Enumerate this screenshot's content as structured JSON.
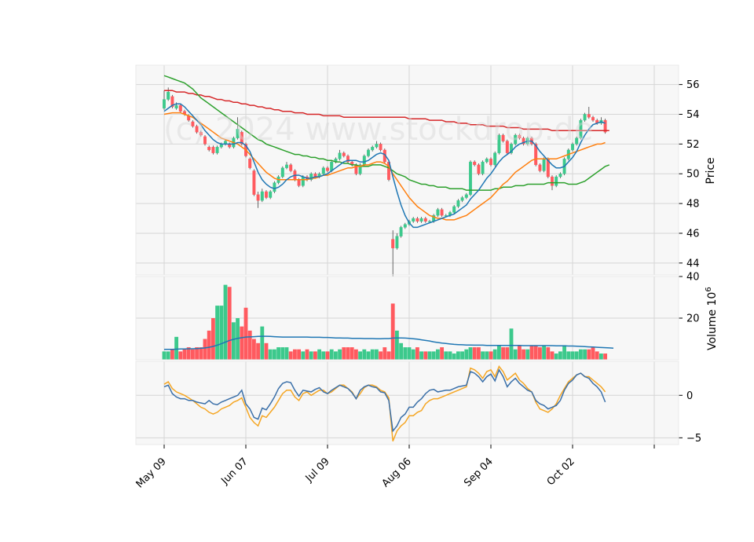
{
  "chart_data": {
    "type": "candlestick",
    "watermark": "(c) 2024 www.stockdrop.de",
    "x_tick_labels": [
      "May 09",
      "Jun 07",
      "Jul 09",
      "Aug 06",
      "Sep 04",
      "Oct 02",
      ""
    ],
    "x_tick_index": [
      0,
      20,
      40,
      60,
      80,
      100,
      120
    ],
    "price_axis": {
      "label": "Price",
      "ticks": [
        44,
        46,
        48,
        50,
        52,
        54,
        56
      ],
      "ylim": [
        43.2,
        57.3
      ]
    },
    "volume_axis": {
      "label": "Volume  10^6",
      "ticks": [
        20,
        40
      ],
      "ylim": [
        0,
        40
      ]
    },
    "osc_axis": {
      "ticks": [
        -5,
        0
      ],
      "ylim": [
        -5.8,
        4.0
      ]
    },
    "colors": {
      "up": "#3cc98c",
      "down": "#ff5a5f",
      "ma_short": "#1f77b4",
      "ma_mid": "#ff7f0e",
      "ma_long": "#2ca02c",
      "ma_200": "#d62728",
      "osc_1": "#3a6fa8",
      "osc_2": "#f5a623",
      "vol_avg": "#1f77b4",
      "panel_bg": "#f7f7f7",
      "grid": "#d6d6d6"
    },
    "close": [
      55.0,
      55.5,
      54.5,
      54.6,
      54.2,
      54.0,
      53.6,
      53.2,
      52.8,
      52.6,
      52.0,
      51.6,
      51.4,
      51.8,
      52.0,
      52.2,
      51.8,
      52.4,
      53.0,
      52.0,
      51.2,
      50.4,
      48.6,
      48.2,
      48.8,
      48.4,
      48.8,
      49.4,
      49.8,
      50.4,
      50.6,
      50.2,
      49.6,
      49.2,
      49.8,
      49.6,
      50.0,
      49.8,
      50.0,
      50.4,
      50.2,
      50.8,
      51.0,
      51.4,
      51.2,
      50.8,
      50.6,
      50.0,
      50.6,
      51.2,
      51.6,
      51.8,
      52.0,
      51.6,
      50.8,
      49.6,
      45.0,
      45.8,
      46.4,
      46.6,
      46.8,
      47.0,
      46.8,
      47.0,
      46.8,
      46.8,
      47.2,
      47.6,
      47.2,
      47.2,
      47.4,
      47.8,
      48.2,
      48.4,
      48.6,
      50.8,
      50.6,
      50.0,
      50.8,
      51.0,
      50.6,
      51.4,
      52.6,
      52.2,
      51.4,
      52.0,
      52.6,
      52.4,
      52.0,
      52.4,
      52.0,
      50.6,
      50.2,
      51.0,
      49.8,
      49.2,
      49.8,
      50.0,
      51.0,
      51.6,
      52.0,
      52.4,
      53.6,
      54.0,
      53.8,
      53.6,
      53.4,
      53.6,
      52.8
    ],
    "open": [
      54.4,
      55.0,
      55.2,
      54.4,
      54.6,
      54.2,
      53.9,
      53.5,
      53.2,
      52.8,
      52.5,
      51.8,
      51.8,
      51.4,
      51.8,
      52.0,
      52.0,
      51.8,
      52.4,
      52.8,
      52.0,
      51.0,
      50.2,
      48.6,
      48.2,
      48.8,
      48.4,
      48.8,
      49.4,
      49.8,
      50.4,
      50.6,
      50.2,
      49.6,
      49.2,
      49.8,
      49.6,
      50.0,
      49.8,
      50.0,
      50.4,
      50.2,
      50.8,
      51.0,
      51.4,
      51.2,
      50.8,
      50.6,
      50.0,
      50.6,
      51.2,
      51.6,
      51.8,
      52.0,
      51.6,
      50.8,
      45.6,
      45.0,
      45.8,
      46.4,
      46.6,
      46.8,
      47.0,
      46.8,
      47.0,
      46.8,
      46.8,
      47.2,
      47.6,
      47.2,
      47.2,
      47.4,
      47.8,
      48.2,
      48.4,
      48.6,
      50.8,
      50.6,
      50.0,
      50.8,
      51.0,
      50.6,
      51.4,
      52.6,
      52.2,
      51.4,
      52.0,
      52.6,
      52.4,
      52.0,
      52.4,
      52.0,
      50.6,
      50.2,
      51.0,
      49.8,
      49.2,
      49.8,
      50.0,
      51.0,
      51.6,
      52.0,
      52.4,
      53.6,
      54.0,
      53.8,
      53.6,
      53.4,
      53.6
    ],
    "high": [
      55.6,
      55.8,
      55.3,
      54.8,
      54.7,
      54.3,
      54.0,
      53.6,
      53.3,
      52.9,
      52.6,
      51.9,
      51.9,
      51.9,
      52.1,
      52.3,
      52.1,
      52.5,
      53.8,
      52.9,
      52.1,
      51.1,
      50.3,
      48.8,
      49.0,
      48.9,
      48.9,
      49.5,
      49.9,
      50.5,
      50.8,
      50.7,
      50.3,
      49.7,
      49.9,
      49.9,
      50.1,
      50.1,
      50.1,
      50.5,
      50.5,
      50.9,
      51.1,
      51.6,
      51.5,
      51.3,
      50.9,
      50.7,
      50.7,
      51.3,
      51.7,
      51.9,
      52.2,
      52.1,
      51.7,
      50.9,
      46.2,
      46.0,
      46.5,
      46.7,
      46.9,
      47.1,
      47.1,
      47.1,
      47.1,
      46.9,
      47.3,
      47.7,
      47.7,
      47.3,
      47.5,
      47.9,
      48.3,
      48.5,
      48.7,
      50.9,
      50.9,
      50.7,
      50.9,
      51.1,
      51.1,
      51.5,
      52.7,
      52.7,
      52.3,
      52.1,
      52.7,
      52.7,
      52.5,
      52.5,
      52.5,
      52.1,
      50.7,
      51.1,
      51.1,
      49.9,
      49.9,
      50.1,
      51.1,
      51.7,
      52.1,
      52.5,
      53.7,
      54.1,
      54.5,
      53.9,
      53.7,
      53.8,
      53.7
    ],
    "low": [
      54.3,
      54.9,
      54.4,
      54.3,
      54.1,
      53.9,
      53.5,
      53.1,
      52.7,
      52.5,
      51.9,
      51.5,
      51.3,
      51.3,
      51.7,
      51.9,
      51.7,
      51.7,
      52.3,
      51.9,
      51.1,
      50.3,
      48.5,
      47.7,
      48.1,
      48.3,
      48.3,
      48.7,
      49.3,
      49.7,
      50.3,
      50.1,
      49.5,
      49.1,
      49.1,
      49.5,
      49.5,
      49.7,
      49.7,
      49.9,
      50.1,
      50.1,
      50.7,
      50.9,
      51.1,
      50.7,
      50.5,
      49.9,
      49.9,
      50.5,
      51.1,
      51.5,
      51.7,
      51.5,
      50.7,
      49.5,
      43.0,
      44.9,
      45.7,
      46.3,
      46.5,
      46.7,
      46.7,
      46.7,
      46.7,
      46.7,
      46.7,
      47.1,
      47.1,
      47.1,
      47.1,
      47.3,
      47.7,
      48.1,
      48.3,
      48.5,
      50.5,
      49.9,
      49.9,
      50.7,
      50.5,
      50.5,
      51.3,
      52.1,
      51.3,
      51.3,
      51.9,
      52.3,
      51.9,
      51.9,
      51.9,
      50.5,
      50.1,
      50.1,
      49.7,
      48.9,
      49.1,
      49.7,
      49.9,
      50.9,
      51.5,
      51.9,
      52.3,
      53.5,
      53.7,
      53.5,
      53.3,
      53.3,
      52.7
    ],
    "volume": [
      4,
      4,
      5,
      11,
      4,
      5,
      6,
      5,
      6,
      6,
      10,
      14,
      20,
      26,
      26,
      36,
      35,
      18,
      20,
      16,
      25,
      14,
      10,
      8,
      16,
      8,
      5,
      5,
      6,
      6,
      6,
      4,
      5,
      5,
      4,
      5,
      4,
      4,
      5,
      4,
      4,
      5,
      4,
      5,
      6,
      6,
      6,
      5,
      4,
      5,
      4,
      5,
      5,
      4,
      6,
      4,
      27,
      14,
      8,
      6,
      6,
      5,
      6,
      4,
      4,
      4,
      4,
      5,
      6,
      4,
      4,
      3,
      4,
      4,
      5,
      6,
      6,
      6,
      4,
      4,
      4,
      5,
      7,
      6,
      6,
      15,
      5,
      7,
      5,
      5,
      7,
      7,
      6,
      7,
      6,
      4,
      3,
      4,
      7,
      4,
      4,
      4,
      5,
      5,
      5,
      6,
      4,
      3,
      3,
      4,
      6
    ],
    "ma_short": [
      54.2,
      54.4,
      54.6,
      54.7,
      54.7,
      54.5,
      54.2,
      53.9,
      53.6,
      53.3,
      52.9,
      52.6,
      52.3,
      52.1,
      52.0,
      52.0,
      52.0,
      52.0,
      52.1,
      52.1,
      51.9,
      51.5,
      50.8,
      50.1,
      49.6,
      49.3,
      49.1,
      49.0,
      49.1,
      49.3,
      49.6,
      49.8,
      49.9,
      49.9,
      49.8,
      49.7,
      49.7,
      49.8,
      49.8,
      49.9,
      50.0,
      50.2,
      50.4,
      50.6,
      50.8,
      50.9,
      50.9,
      50.9,
      50.8,
      50.8,
      50.9,
      51.1,
      51.3,
      51.4,
      51.3,
      50.9,
      49.8,
      48.8,
      47.9,
      47.2,
      46.7,
      46.4,
      46.4,
      46.5,
      46.6,
      46.7,
      46.8,
      46.9,
      47.0,
      47.1,
      47.2,
      47.3,
      47.5,
      47.7,
      47.9,
      48.3,
      48.6,
      48.9,
      49.3,
      49.7,
      50.0,
      50.4,
      50.8,
      51.1,
      51.3,
      51.5,
      51.8,
      52.0,
      52.1,
      52.2,
      52.2,
      51.9,
      51.5,
      51.2,
      50.9,
      50.6,
      50.4,
      50.4,
      50.5,
      50.8,
      51.1,
      51.5,
      52.1,
      52.6,
      53.0,
      53.3,
      53.4,
      53.5,
      53.4
    ],
    "ma_mid": [
      54.0,
      54.05,
      54.1,
      54.1,
      54.1,
      54.0,
      53.9,
      53.8,
      53.6,
      53.4,
      53.2,
      53.0,
      52.8,
      52.6,
      52.4,
      52.3,
      52.2,
      52.1,
      52.0,
      51.8,
      51.6,
      51.3,
      51.0,
      50.7,
      50.4,
      50.1,
      49.9,
      49.7,
      49.6,
      49.6,
      49.6,
      49.6,
      49.6,
      49.6,
      49.6,
      49.6,
      49.7,
      49.7,
      49.8,
      49.9,
      49.9,
      50.0,
      50.1,
      50.2,
      50.3,
      50.4,
      50.4,
      50.5,
      50.5,
      50.6,
      50.6,
      50.7,
      50.8,
      50.8,
      50.7,
      50.5,
      50.0,
      49.6,
      49.2,
      48.8,
      48.4,
      48.1,
      47.8,
      47.6,
      47.4,
      47.2,
      47.1,
      47.0,
      47.0,
      46.9,
      46.9,
      46.9,
      47.0,
      47.1,
      47.2,
      47.4,
      47.6,
      47.8,
      48.0,
      48.2,
      48.4,
      48.7,
      49.0,
      49.3,
      49.5,
      49.8,
      50.1,
      50.3,
      50.5,
      50.7,
      50.9,
      51.0,
      51.0,
      51.0,
      51.0,
      51.0,
      51.0,
      51.1,
      51.2,
      51.3,
      51.4,
      51.5,
      51.6,
      51.7,
      51.8,
      51.9,
      52.0,
      52.0,
      52.1
    ],
    "ma_long": [
      56.6,
      56.5,
      56.4,
      56.3,
      56.2,
      56.1,
      55.9,
      55.7,
      55.4,
      55.1,
      54.9,
      54.7,
      54.5,
      54.3,
      54.1,
      53.9,
      53.7,
      53.5,
      53.3,
      53.1,
      52.9,
      52.7,
      52.5,
      52.3,
      52.2,
      52.0,
      51.9,
      51.8,
      51.7,
      51.6,
      51.5,
      51.4,
      51.3,
      51.3,
      51.2,
      51.2,
      51.1,
      51.1,
      51.0,
      51.0,
      50.9,
      50.9,
      50.8,
      50.8,
      50.7,
      50.7,
      50.6,
      50.6,
      50.5,
      50.5,
      50.5,
      50.6,
      50.6,
      50.6,
      50.5,
      50.4,
      50.2,
      50.0,
      49.9,
      49.8,
      49.6,
      49.5,
      49.4,
      49.3,
      49.3,
      49.2,
      49.2,
      49.1,
      49.1,
      49.1,
      49.0,
      49.0,
      49.0,
      49.0,
      48.9,
      48.9,
      48.9,
      48.9,
      48.9,
      48.9,
      48.9,
      49.0,
      49.0,
      49.1,
      49.1,
      49.1,
      49.2,
      49.2,
      49.2,
      49.3,
      49.3,
      49.3,
      49.3,
      49.3,
      49.4,
      49.4,
      49.4,
      49.4,
      49.4,
      49.3,
      49.3,
      49.3,
      49.4,
      49.5,
      49.7,
      49.9,
      50.1,
      50.3,
      50.5,
      50.6
    ],
    "ma_200": [
      55.6,
      55.6,
      55.6,
      55.5,
      55.5,
      55.5,
      55.4,
      55.4,
      55.3,
      55.3,
      55.2,
      55.2,
      55.1,
      55.0,
      55.0,
      54.9,
      54.9,
      54.8,
      54.8,
      54.7,
      54.7,
      54.6,
      54.6,
      54.5,
      54.5,
      54.4,
      54.4,
      54.3,
      54.3,
      54.2,
      54.2,
      54.2,
      54.1,
      54.1,
      54.1,
      54.0,
      54.0,
      54.0,
      54.0,
      53.9,
      53.9,
      53.9,
      53.9,
      53.9,
      53.8,
      53.8,
      53.8,
      53.8,
      53.8,
      53.8,
      53.8,
      53.8,
      53.8,
      53.8,
      53.8,
      53.8,
      53.8,
      53.8,
      53.8,
      53.8,
      53.7,
      53.7,
      53.7,
      53.7,
      53.7,
      53.6,
      53.6,
      53.6,
      53.6,
      53.5,
      53.5,
      53.5,
      53.4,
      53.4,
      53.4,
      53.3,
      53.3,
      53.3,
      53.3,
      53.2,
      53.2,
      53.2,
      53.2,
      53.2,
      53.1,
      53.1,
      53.1,
      53.1,
      53.0,
      53.0,
      53.0,
      53.0,
      53.0,
      53.0,
      53.0,
      52.9,
      52.9,
      52.9,
      52.9,
      52.9,
      52.9,
      52.9,
      52.9,
      52.9,
      52.9,
      52.9,
      52.9,
      52.9,
      52.9,
      52.9
    ],
    "vol_avg": [
      5.0,
      5.0,
      5.0,
      5.1,
      5.2,
      5.2,
      5.3,
      5.3,
      5.4,
      5.5,
      5.7,
      6.0,
      6.4,
      7.0,
      7.7,
      8.5,
      9.3,
      9.8,
      10.3,
      10.6,
      10.9,
      11.0,
      11.1,
      11.2,
      11.3,
      11.3,
      11.2,
      11.1,
      11.0,
      10.9,
      10.9,
      10.9,
      10.9,
      10.9,
      10.9,
      10.9,
      10.8,
      10.8,
      10.8,
      10.7,
      10.7,
      10.6,
      10.5,
      10.5,
      10.4,
      10.4,
      10.3,
      10.3,
      10.3,
      10.2,
      10.2,
      10.2,
      10.1,
      10.1,
      10.2,
      10.2,
      10.4,
      10.5,
      10.5,
      10.4,
      10.3,
      10.1,
      9.9,
      9.6,
      9.3,
      9.0,
      8.6,
      8.3,
      8.0,
      7.8,
      7.6,
      7.4,
      7.3,
      7.2,
      7.1,
      7.1,
      7.0,
      7.0,
      7.0,
      6.9,
      6.9,
      6.9,
      6.9,
      6.9,
      6.9,
      6.9,
      6.9,
      6.9,
      6.8,
      6.8,
      6.8,
      6.8,
      6.8,
      6.8,
      6.8,
      6.8,
      6.7,
      6.7,
      6.7,
      6.6,
      6.6,
      6.5,
      6.4,
      6.3,
      6.2,
      6.1,
      6.0,
      5.9,
      5.8,
      5.7,
      5.6
    ],
    "osc_1": [
      1.0,
      1.2,
      0.2,
      -0.2,
      -0.4,
      -0.4,
      -0.6,
      -0.6,
      -0.8,
      -0.9,
      -1.0,
      -0.6,
      -1.0,
      -1.1,
      -0.8,
      -0.6,
      -0.4,
      -0.2,
      0.0,
      0.6,
      -1.0,
      -1.6,
      -2.6,
      -2.8,
      -1.5,
      -1.7,
      -1.0,
      -0.2,
      0.8,
      1.4,
      1.6,
      1.5,
      0.6,
      -0.1,
      0.6,
      0.5,
      0.4,
      0.7,
      0.9,
      0.4,
      0.2,
      0.6,
      0.9,
      1.2,
      1.0,
      0.8,
      0.3,
      -0.4,
      0.6,
      1.0,
      1.2,
      1.0,
      0.9,
      0.4,
      0.3,
      -0.6,
      -4.2,
      -3.6,
      -2.6,
      -2.2,
      -1.4,
      -1.4,
      -0.8,
      -0.4,
      0.2,
      0.6,
      0.7,
      0.4,
      0.5,
      0.6,
      0.6,
      0.8,
      1.0,
      1.1,
      1.2,
      2.8,
      2.6,
      2.2,
      1.6,
      2.2,
      2.5,
      1.7,
      3.0,
      2.2,
      1.0,
      1.6,
      2.0,
      1.4,
      1.0,
      0.6,
      0.4,
      -0.6,
      -1.0,
      -1.2,
      -1.6,
      -1.4,
      -1.2,
      -0.6,
      0.6,
      1.4,
      1.8,
      2.4,
      2.6,
      2.2,
      2.0,
      1.4,
      1.0,
      0.4,
      -0.8
    ],
    "osc_2": [
      1.3,
      1.6,
      0.8,
      0.4,
      0.2,
      0.0,
      -0.3,
      -0.6,
      -1.0,
      -1.4,
      -1.6,
      -2.0,
      -2.2,
      -2.0,
      -1.6,
      -1.4,
      -1.2,
      -0.8,
      -0.6,
      -0.3,
      -1.4,
      -2.6,
      -3.2,
      -3.6,
      -2.4,
      -2.6,
      -2.0,
      -1.4,
      -0.6,
      0.2,
      0.6,
      0.6,
      -0.2,
      -0.6,
      0.2,
      0.4,
      0.0,
      0.3,
      0.6,
      0.6,
      0.2,
      0.4,
      0.8,
      1.2,
      1.2,
      0.8,
      0.4,
      -0.4,
      0.2,
      0.9,
      1.2,
      1.2,
      1.0,
      0.6,
      0.4,
      -0.3,
      -5.4,
      -4.2,
      -3.6,
      -3.2,
      -2.4,
      -2.4,
      -2.0,
      -1.8,
      -1.0,
      -0.6,
      -0.4,
      -0.4,
      -0.2,
      0.0,
      0.2,
      0.4,
      0.6,
      0.8,
      1.0,
      3.2,
      3.0,
      2.6,
      2.0,
      2.8,
      3.0,
      2.2,
      3.4,
      2.8,
      1.8,
      2.2,
      2.6,
      1.8,
      1.4,
      0.8,
      0.4,
      -0.8,
      -1.6,
      -1.8,
      -2.0,
      -1.6,
      -1.0,
      0.0,
      0.8,
      1.6,
      2.0,
      2.4,
      2.6,
      2.2,
      2.2,
      1.8,
      1.4,
      1.0,
      0.4
    ]
  }
}
